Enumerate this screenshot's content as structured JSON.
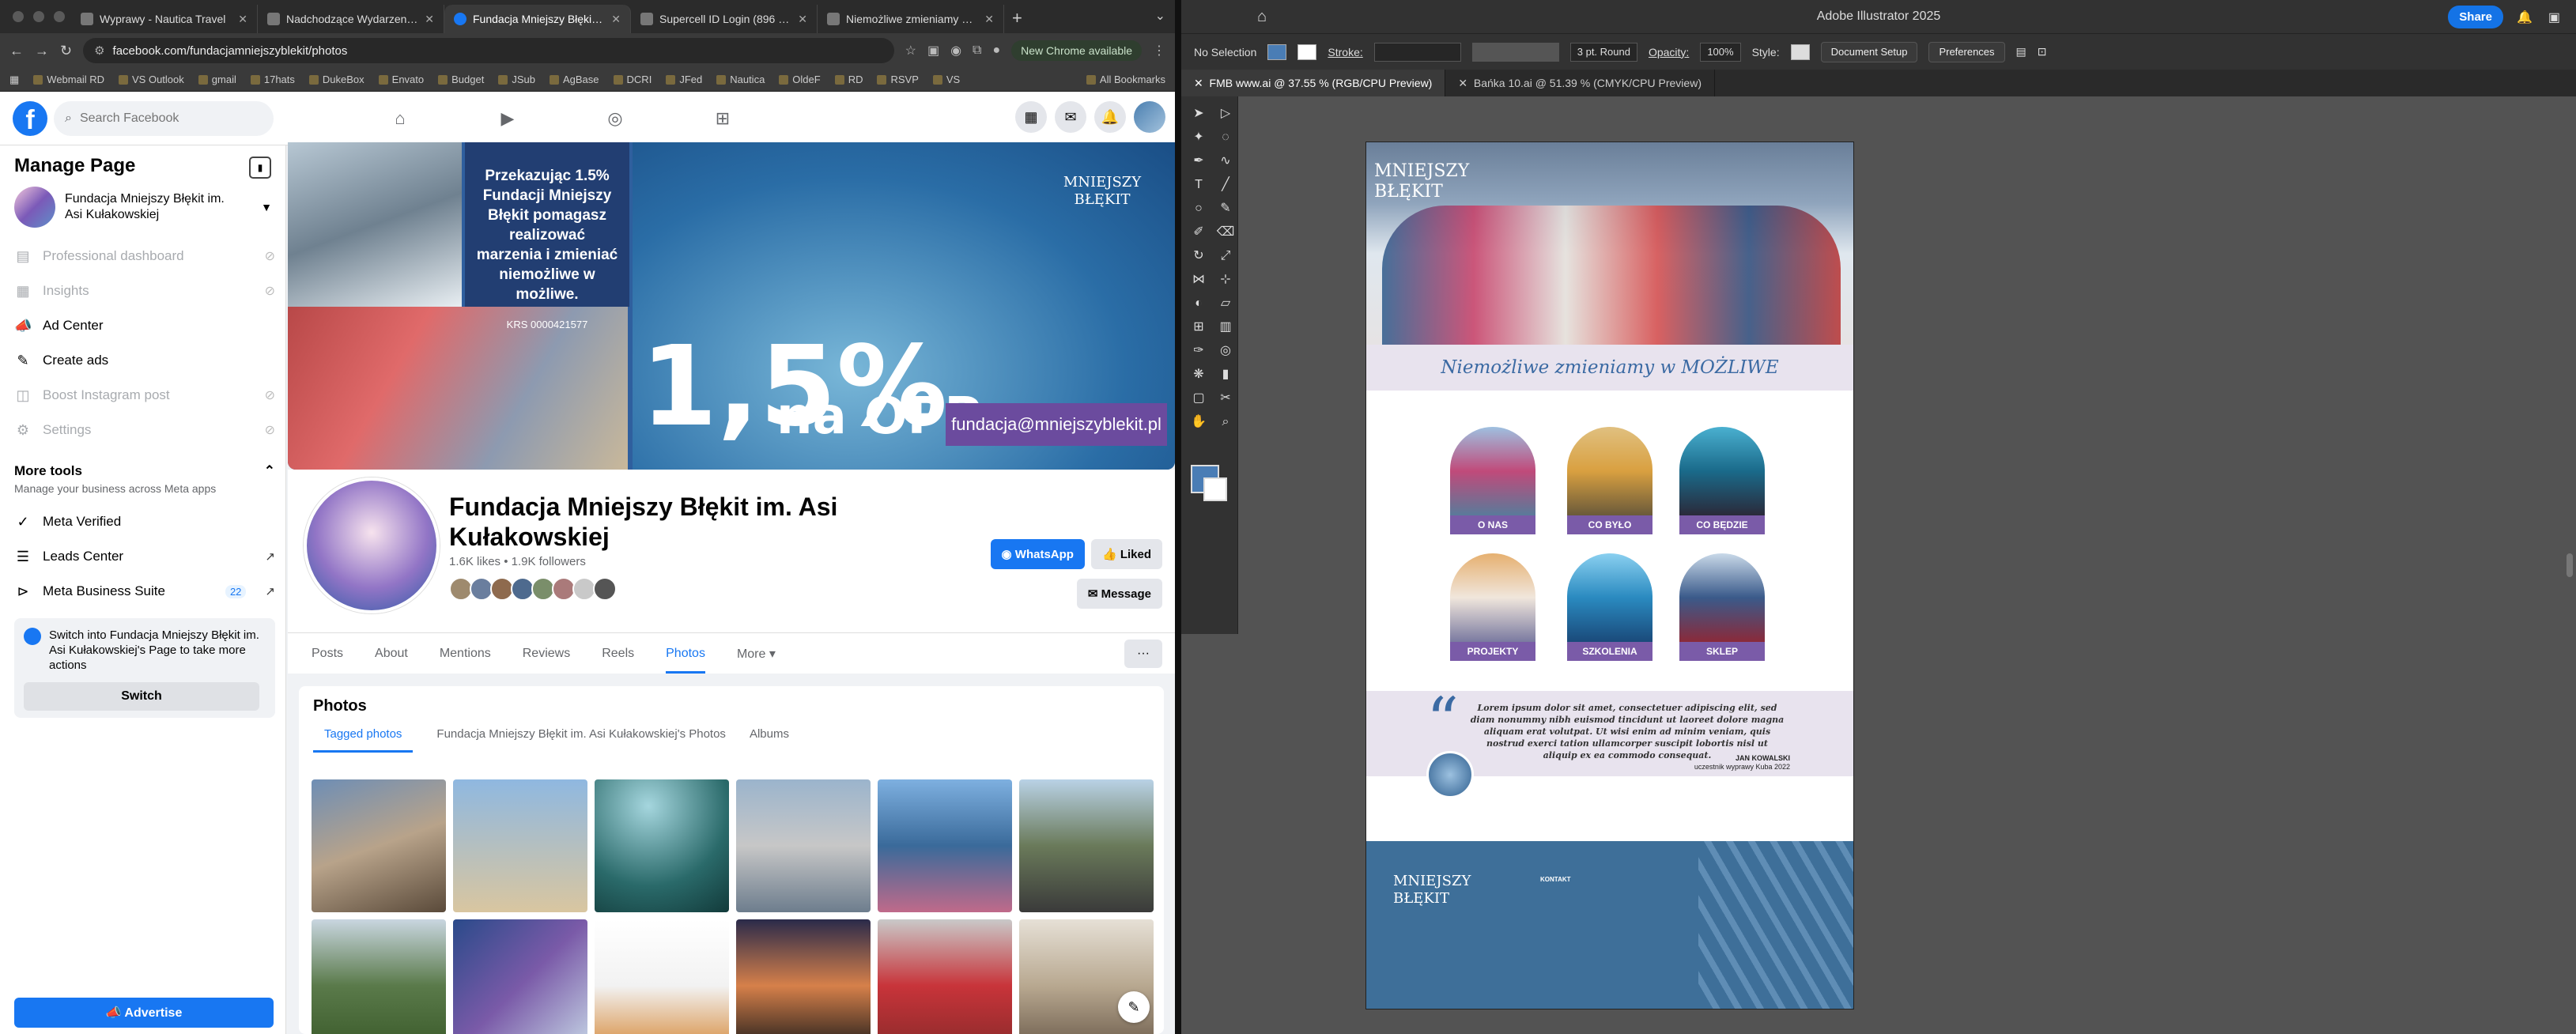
{
  "browser": {
    "tabs": [
      {
        "title": "Wyprawy - Nautica Travel",
        "active": false
      },
      {
        "title": "Nadchodzące Wydarzenia Mi",
        "active": false
      },
      {
        "title": "Fundacja Mniejszy Błękit im.",
        "active": true
      },
      {
        "title": "Supercell ID Login (896 424)",
        "active": false
      },
      {
        "title": "Niemożliwe zmieniamy w MO",
        "active": false
      }
    ],
    "url": "facebook.com/fundacjamniejszyblekit/photos",
    "update_label": "New Chrome available",
    "bookmarks": [
      "Webmail RD",
      "VS Outlook",
      "gmail",
      "17hats",
      "DukeBox",
      "Envato",
      "Budget",
      "JSub",
      "AgBase",
      "DCRI",
      "JFed",
      "Nautica",
      "OldeF",
      "RD",
      "RSVP",
      "VS"
    ],
    "all_bookmarks": "All Bookmarks"
  },
  "fb": {
    "search_placeholder": "Search Facebook",
    "sidebar": {
      "title": "Manage Page",
      "page_name": "Fundacja Mniejszy Błękit im. Asi Kułakowskiej",
      "items": [
        {
          "label": "Professional dashboard",
          "icon": "dashboard-icon",
          "disabled": true
        },
        {
          "label": "Insights",
          "icon": "insights-icon",
          "disabled": true
        },
        {
          "label": "Ad Center",
          "icon": "megaphone-icon",
          "disabled": false
        },
        {
          "label": "Create ads",
          "icon": "pencil-icon",
          "disabled": false
        },
        {
          "label": "Boost Instagram post",
          "icon": "boost-icon",
          "disabled": true
        },
        {
          "label": "Settings",
          "icon": "gear-icon",
          "disabled": true
        }
      ],
      "more_tools_title": "More tools",
      "more_tools_sub": "Manage your business across Meta apps",
      "tools": [
        {
          "label": "Meta Verified"
        },
        {
          "label": "Leads Center"
        },
        {
          "label": "Meta Business Suite",
          "badge": "22"
        }
      ],
      "switch_text": "Switch into Fundacja Mniejszy Błękit im. Asi Kułakowskiej's Page to take more actions",
      "switch_button": "Switch",
      "advertise_button": "Advertise"
    },
    "cover": {
      "headline": "Przekazując 1.5% Fundacji Mniejszy Błękit pomagasz realizować marzenia i zmieniać niemożliwe w możliwe.",
      "krs": "KRS 0000421577",
      "big_number": "1,5%",
      "opp": "na OPP",
      "email": "fundacja@mniejszyblekit.pl",
      "logo": "MNIEJSZY BŁĘKIT"
    },
    "profile": {
      "name": "Fundacja Mniejszy Błękit im. Asi Kułakowskiej",
      "stats": "1.6K likes • 1.9K followers",
      "whatsapp": "WhatsApp",
      "liked": "Liked",
      "message": "Message"
    },
    "tabs": [
      "Posts",
      "About",
      "Mentions",
      "Reviews",
      "Reels",
      "Photos",
      "More ▾"
    ],
    "active_tab": "Photos",
    "photos": {
      "title": "Photos",
      "subtabs": [
        "Tagged photos",
        "Fundacja Mniejszy Błękit im. Asi Kułakowskiej's Photos",
        "Albums"
      ]
    }
  },
  "ai": {
    "app_title": "Adobe Illustrator 2025",
    "share": "Share",
    "selection": "No Selection",
    "stroke_label": "Stroke:",
    "brush": "3 pt. Round",
    "opacity_label": "Opacity:",
    "opacity_value": "100%",
    "style_label": "Style:",
    "doc_setup": "Document Setup",
    "preferences": "Preferences",
    "doc_tabs": [
      {
        "label": "FMB www.ai @ 37.55 % (RGB/CPU Preview)",
        "active": true
      },
      {
        "label": "Bańka 10.ai @ 51.39 % (CMYK/CPU Preview)",
        "active": false
      }
    ],
    "artboard": {
      "logo": "MNIEJSZY BŁĘKIT",
      "tagline": "Niemożliwe zmieniamy w MOŻLIWE",
      "tiles": [
        "O NAS",
        "CO BYŁO",
        "CO BĘDZIE",
        "PROJEKTY",
        "SZKOLENIA",
        "SKLEP"
      ],
      "quote": "Lorem ipsum dolor sit amet, consectetuer adipiscing elit, sed diam nonummy nibh euismod tincidunt ut laoreet dolore magna aliquam erat volutpat. Ut wisi enim ad minim veniam, quis nostrud exerci tation ullamcorper suscipit lobortis nisl ut aliquip ex ea commodo consequat.",
      "quote_author": "JAN KOWALSKI",
      "quote_role": "uczestnik wyprawy Kuba 2022",
      "footer_logo": "MNIEJSZY BŁĘKIT",
      "footer_contact": "KONTAKT"
    }
  }
}
